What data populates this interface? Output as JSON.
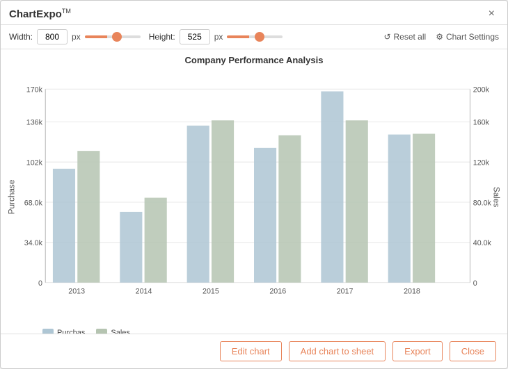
{
  "dialog": {
    "title": "ChartExpo",
    "title_sup": "TM",
    "close_label": "×"
  },
  "toolbar": {
    "width_label": "Width:",
    "width_value": "800",
    "height_label": "Height:",
    "height_value": "525",
    "px_label": "px",
    "reset_label": "Reset all",
    "settings_label": "Chart Settings"
  },
  "chart": {
    "title": "Company Performance Analysis",
    "y_left_label": "Purchase",
    "y_right_label": "Sales",
    "y_left_ticks": [
      "170k",
      "136k",
      "102k",
      "68.0k",
      "34.0k",
      "0"
    ],
    "y_right_ticks": [
      "200k",
      "160k",
      "120k",
      "80.0k",
      "40.0k",
      "0"
    ],
    "x_labels": [
      "2013",
      "2014",
      "2015",
      "2016",
      "2017",
      "2018"
    ],
    "legend": [
      {
        "label": "Purchas",
        "color": "#aec6d4"
      },
      {
        "label": "Sales",
        "color": "#b5c4b1"
      }
    ],
    "bars": [
      {
        "year": "2013",
        "purchase": 100000,
        "sales": 132000
      },
      {
        "year": "2014",
        "purchase": 62000,
        "sales": 88000
      },
      {
        "year": "2015",
        "purchase": 138000,
        "sales": 168000
      },
      {
        "year": "2016",
        "purchase": 118000,
        "sales": 152000
      },
      {
        "year": "2017",
        "purchase": 168000,
        "sales": 168000
      },
      {
        "year": "2018",
        "purchase": 130000,
        "sales": 155000
      }
    ]
  },
  "footer": {
    "edit_chart": "Edit chart",
    "add_to_sheet": "Add chart to sheet",
    "export": "Export",
    "close": "Close"
  }
}
